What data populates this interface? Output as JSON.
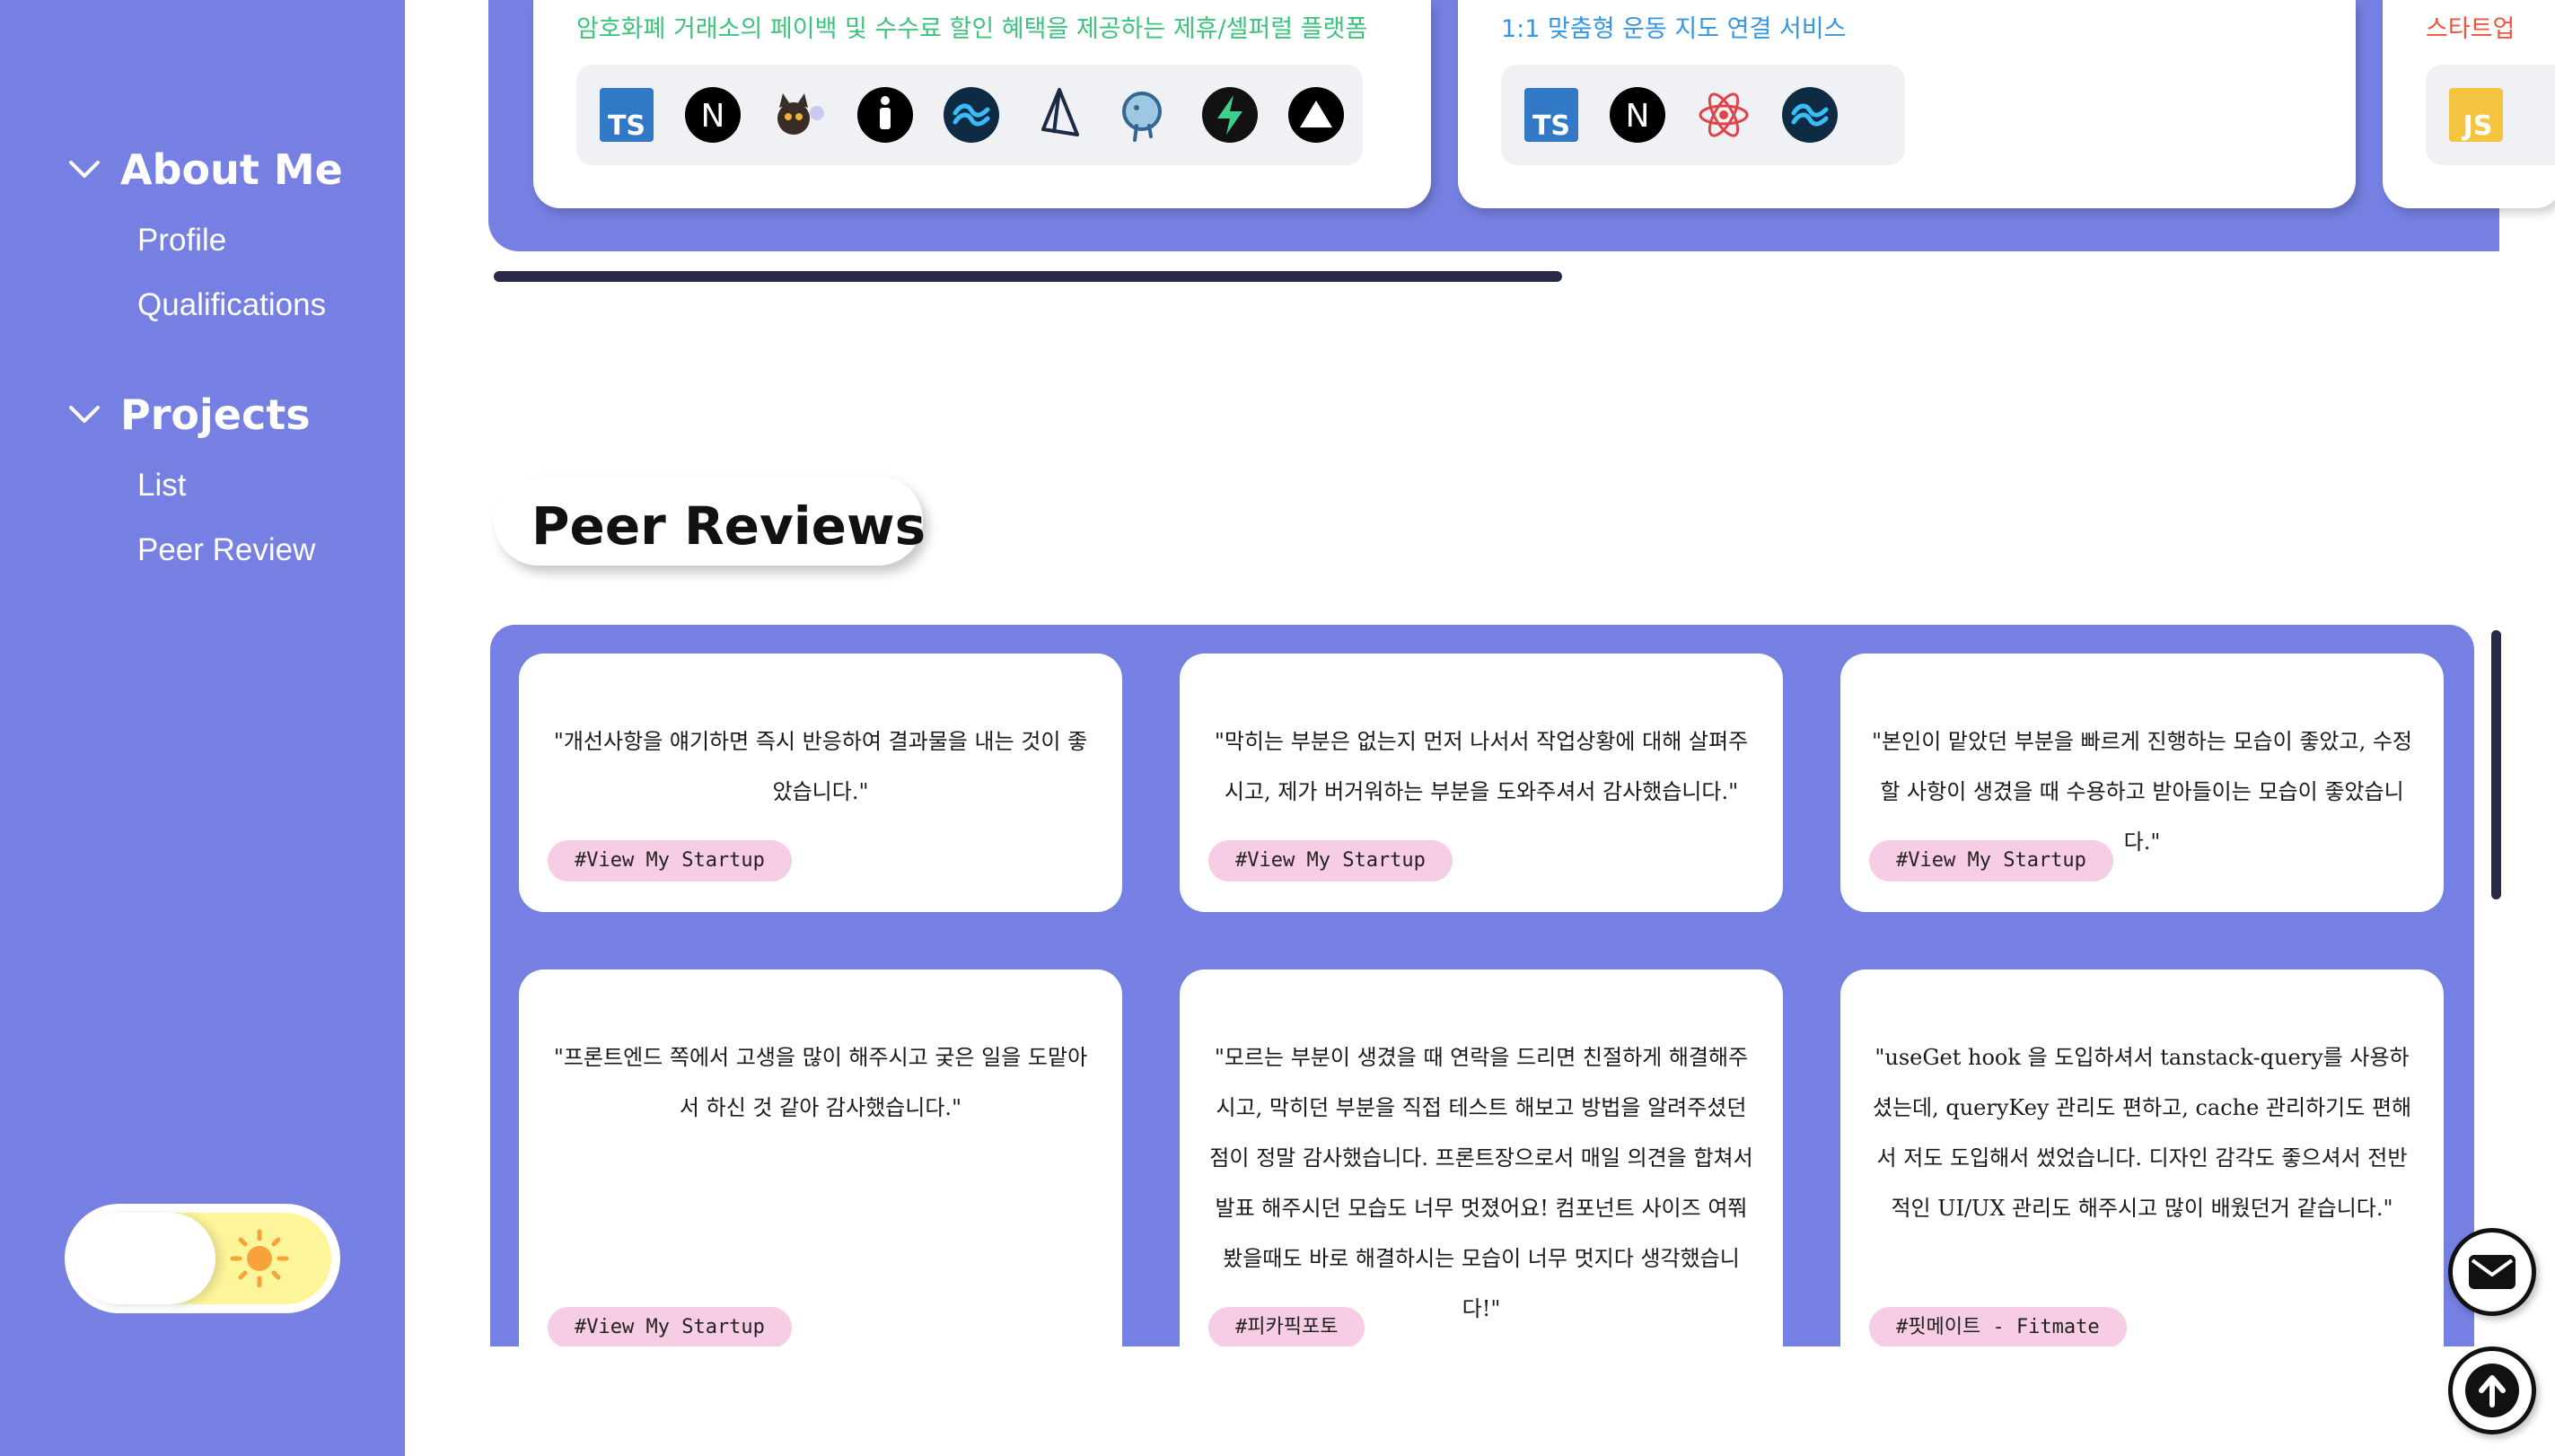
{
  "sidebar": {
    "sections": [
      {
        "title": "About Me",
        "items": [
          "Profile",
          "Qualifications"
        ]
      },
      {
        "title": "Projects",
        "items": [
          "List",
          "Peer Review"
        ]
      }
    ],
    "theme": "light"
  },
  "projects": {
    "cards": [
      {
        "description": "암호화폐 거래소의 페이백 및 수수료 할인 혜택을 제공하는 제휴/셀퍼럴 플랫폼",
        "color": "#3cc47c",
        "stack": [
          "typescript-icon",
          "nextjs-icon",
          "cat-mascot-icon",
          "icon-i",
          "tailwind-icon",
          "prisma-icon",
          "postgresql-icon",
          "supabase-icon",
          "vercel-icon"
        ]
      },
      {
        "description": "1:1 맞춤형 운동 지도 연결 서비스",
        "color": "#3596e4",
        "stack": [
          "typescript-icon",
          "nextjs-icon",
          "react-icon",
          "tailwind-icon"
        ]
      },
      {
        "description": "스타트업",
        "color": "#f0553c",
        "stack": [
          "javascript-icon"
        ]
      }
    ]
  },
  "peer_reviews": {
    "title": "Peer Reviews",
    "reviews": [
      {
        "text": "\"개선사항을 얘기하면 즉시 반응하여 결과물을 내는 것이 좋았습니다.\"",
        "tag": "#View My Startup"
      },
      {
        "text": "\"막히는 부분은 없는지 먼저 나서서 작업상황에 대해 살펴주시고, 제가 버거워하는 부분을 도와주셔서 감사했습니다.\"",
        "tag": "#View My Startup"
      },
      {
        "text": "\"본인이 맡았던 부분을 빠르게 진행하는 모습이 좋았고, 수정할 사항이 생겼을 때 수용하고 받아들이는 모습이 좋았습니다.\"",
        "tag": "#View My Startup"
      },
      {
        "text": "\"프론트엔드 쪽에서 고생을 많이 해주시고 궂은 일을 도맡아서 하신 것 같아 감사했습니다.\"",
        "tag": "#View My Startup"
      },
      {
        "text": "\"모르는 부분이 생겼을 때 연락을 드리면 친절하게 해결해주시고, 막히던 부분을 직접 테스트 해보고 방법을 알려주셨던 점이 정말 감사했습니다. 프론트장으로서 매일 의견을 합쳐서 발표 해주시던 모습도 너무 멋졌어요! 컴포넌트 사이즈 여쭤봤을때도 바로 해결하시는 모습이 너무 멋지다 생각했습니다!\"",
        "tag": "#피카픽포토"
      },
      {
        "text": "\"useGet hook 을 도입하셔서 tanstack-query를 사용하셨는데, queryKey 관리도 편하고, cache 관리하기도 편해서 저도 도입해서 썼었습니다. 디자인 감각도 좋으셔서 전반적인 UI/UX 관리도 해주시고 많이 배웠던거 같습니다.\"",
        "tag": "#핏메이트 - Fitmate"
      }
    ]
  },
  "colors": {
    "panel": "#7680e2",
    "tag_bg": "#f6cde4",
    "scroll": "#282947",
    "toggle_track": "#fcf59a",
    "sun": "#f7a23b"
  },
  "actions": [
    "mail-button",
    "scroll-to-top-button"
  ]
}
